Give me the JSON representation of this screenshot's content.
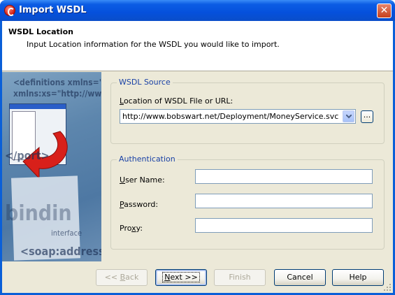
{
  "window": {
    "title": "Import WSDL"
  },
  "header": {
    "title": "WSDL Location",
    "subtitle": "Input Location information for the WSDL you would like to import."
  },
  "art": {
    "lines": [
      "<definitions xmlns=\"",
      "xmlns:xs=\"http://www.w",
      "</port>",
      "bindin",
      "interface",
      "<soap:address"
    ]
  },
  "wsdl_source": {
    "legend": "WSDL Source",
    "location_label_pre": "",
    "location_label_accel": "L",
    "location_label_post": "ocation of WSDL File or URL:",
    "location_value": "http://www.bobswart.net/Deployment/MoneyService.svc?wsdl",
    "browse_label": "..."
  },
  "authentication": {
    "legend": "Authentication",
    "username_accel": "U",
    "username_rest": "ser Name:",
    "password_accel": "P",
    "password_rest": "assword:",
    "proxy_pre": "Pro",
    "proxy_accel": "x",
    "proxy_post": "y:",
    "username_value": "",
    "password_value": "",
    "proxy_value": ""
  },
  "buttons": {
    "back_pre": "<< ",
    "back_accel": "B",
    "back_post": "ack",
    "next_accel": "N",
    "next_post": "ext >>",
    "finish": "Finish",
    "cancel": "Cancel",
    "help": "Help"
  }
}
